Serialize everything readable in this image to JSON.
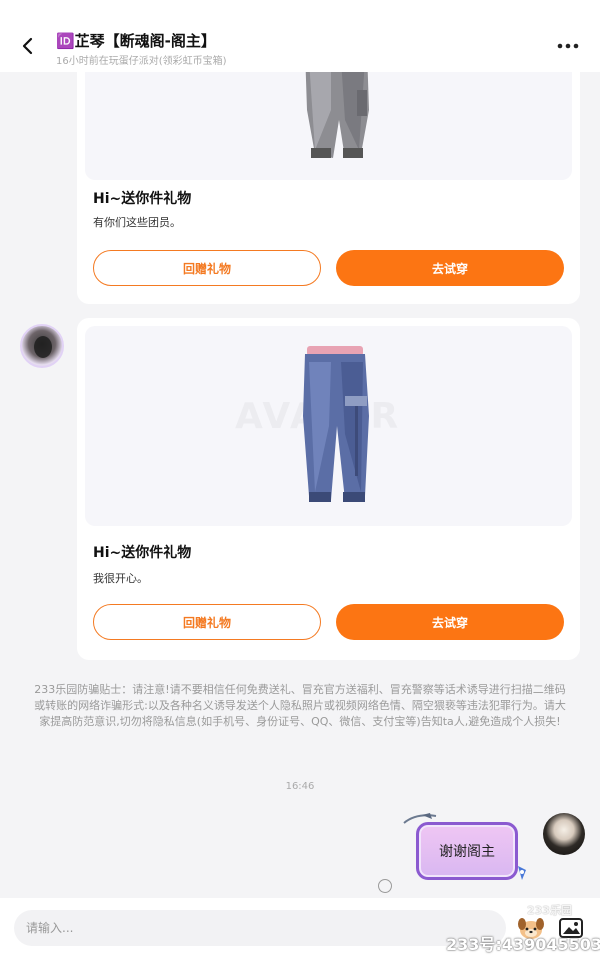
{
  "header": {
    "back_icon": "chevron-left-icon",
    "title": "🆔芷琴【断魂阁-阁主】",
    "subtitle": "16小时前在玩蛋仔派对(领彩虹币宝箱)",
    "more_icon": "more-dots-icon"
  },
  "cards": [
    {
      "title": "Hi~送你件礼物",
      "text": "有你们这些团员。",
      "reply_label": "回赠礼物",
      "try_label": "去试穿",
      "item_icon": "grey-cargo-pants-icon"
    },
    {
      "title": "Hi~送你件礼物",
      "text": "我很开心。",
      "reply_label": "回赠礼物",
      "try_label": "去试穿",
      "item_icon": "blue-cargo-pants-icon",
      "watermark": "AVATAR"
    }
  ],
  "notice": "233乐园防骗贴士：请注意!请不要相信任何免费送礼、冒充官方送福利、冒充警察等话术诱导进行扫描二维码或转账的网络诈骗形式:以及各种名义诱导发送个人隐私照片或视频网络色情、隔空猥亵等违法犯罪行为。请大家提高防范意识,切勿将隐私信息(如手机号、身份证号、QQ、微信、支付宝等)告知ta人,避免造成个人损失!",
  "timestamp": "16:46",
  "my_message": "谢谢阁主",
  "input": {
    "placeholder": "请输入...",
    "emoji_icon": "emoji-dog-icon",
    "image_icon": "image-icon"
  },
  "watermark": {
    "logo": "233乐园",
    "id": "233号:439045503"
  },
  "colors": {
    "accent": "#fc7513",
    "bubble_border": "#8b5ad0",
    "bubble_fill": "#e5bff4"
  }
}
